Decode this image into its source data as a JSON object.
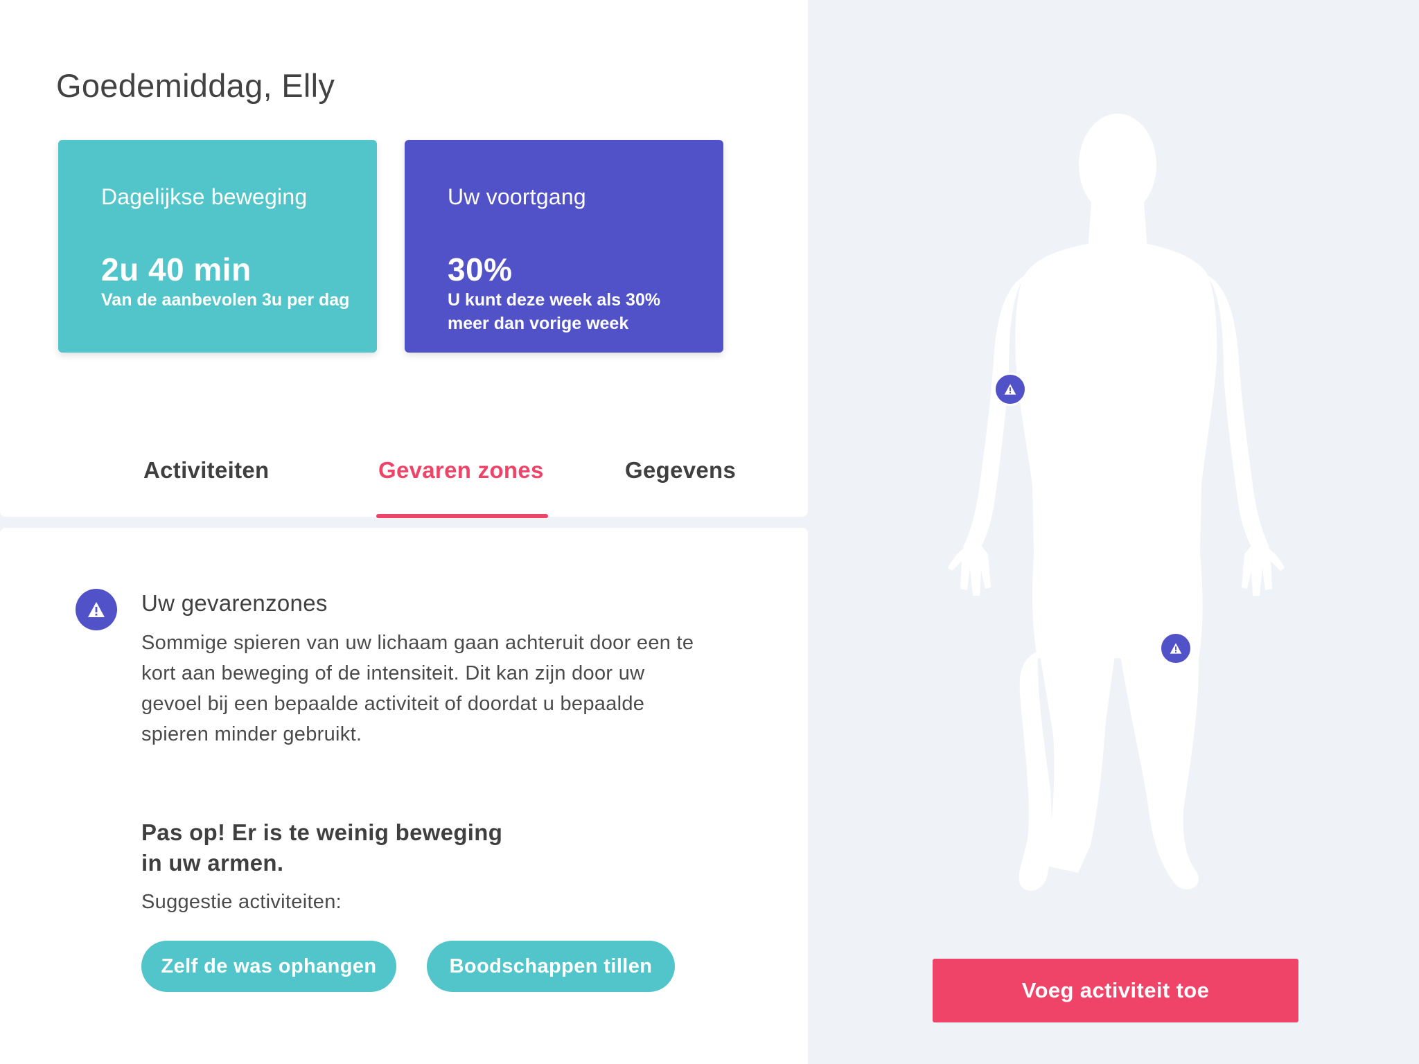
{
  "greeting": "Goedemiddag, Elly",
  "cards": [
    {
      "title": "Dagelijkse beweging",
      "value": "2u 40 min",
      "sub": "Van de aanbevolen 3u per dag",
      "color": "#51c5c9"
    },
    {
      "title": "Uw voortgang",
      "value": "30%",
      "sub": "U kunt deze week als 30% meer dan vorige week",
      "color": "#5252c8"
    }
  ],
  "tabs": [
    {
      "label": "Activiteiten"
    },
    {
      "label": "Gevaren zones",
      "active": true
    },
    {
      "label": "Gegevens"
    }
  ],
  "danger": {
    "icon": "warning-triangle-icon",
    "title": "Uw gevarenzones",
    "body": "Sommige spieren van uw lichaam gaan achteruit door een te kort aan beweging of de intensiteit. Dit kan zijn door uw gevoel bij een bepaalde activiteit of doordat u bepaalde spieren minder gebruikt.",
    "alert": "Pas op! Er is te weinig beweging in uw armen.",
    "suggest_label": "Suggestie activiteiten:",
    "suggestions": [
      "Zelf de was ophangen",
      "Boodschappen tillen"
    ]
  },
  "body_map": {
    "figure": "human-body-silhouette",
    "markers": [
      "left-arm-warning",
      "right-knee-warning"
    ]
  },
  "add_button": "Voeg activiteit toe",
  "colors": {
    "accent": "#ee4468",
    "teal": "#51c5c9",
    "purple": "#5252c8",
    "background": "#eff2f7"
  }
}
